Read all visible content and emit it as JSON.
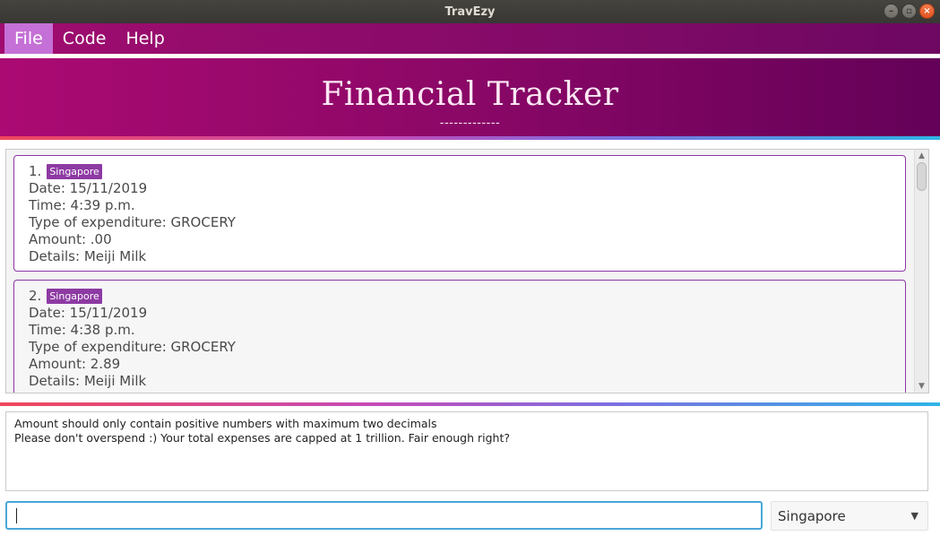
{
  "window": {
    "title": "TravEzy"
  },
  "menu": {
    "items": [
      "File",
      "Code",
      "Help"
    ],
    "active": "File"
  },
  "header": {
    "title": "Financial Tracker",
    "underline": "-------------"
  },
  "expenditures": [
    {
      "index": "1.",
      "tag": "Singapore",
      "date": "Date: 15/11/2019",
      "time": "Time: 4:39 p.m.",
      "type": "Type of expenditure: GROCERY",
      "amount": "Amount: .00",
      "details": "Details: Meiji Milk"
    },
    {
      "index": "2.",
      "tag": "Singapore",
      "date": "Date: 15/11/2019",
      "time": "Time: 4:38 p.m.",
      "type": "Type of expenditure: GROCERY",
      "amount": "Amount: 2.89",
      "details": "Details: Meiji Milk"
    }
  ],
  "result": {
    "line1": "Amount should only contain positive numbers with maximum two decimals",
    "line2": "Please don't overspend :) Your total expenses are capped at 1 trillion. Fair enough right?"
  },
  "command": {
    "value": "",
    "placeholder": ""
  },
  "country_select": {
    "selected": "Singapore"
  },
  "colors": {
    "menu_gradient": [
      "#a00c6f",
      "#6d0862"
    ],
    "tag": "#8d3aa3",
    "card_border": "#8e35a8",
    "input_focus": "#4aa7d9"
  }
}
